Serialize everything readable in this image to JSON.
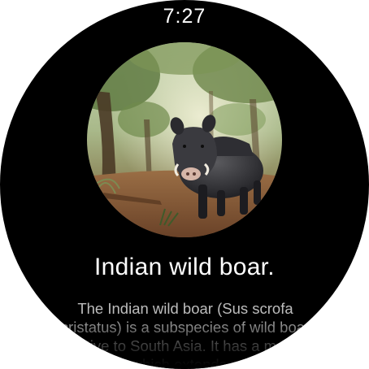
{
  "status": {
    "time": "7:27"
  },
  "hero": {
    "image_subject": "indian-wild-boar-in-forest"
  },
  "article": {
    "title": "Indian wild boar.",
    "description": "The Indian wild boar (Sus scrofa cristatus) is a subspecies of wild boar native to South Asia. It has a mane which extends..."
  },
  "colors": {
    "background": "#000000",
    "title": "#ffffff",
    "body_text": "#bdbdbd"
  }
}
